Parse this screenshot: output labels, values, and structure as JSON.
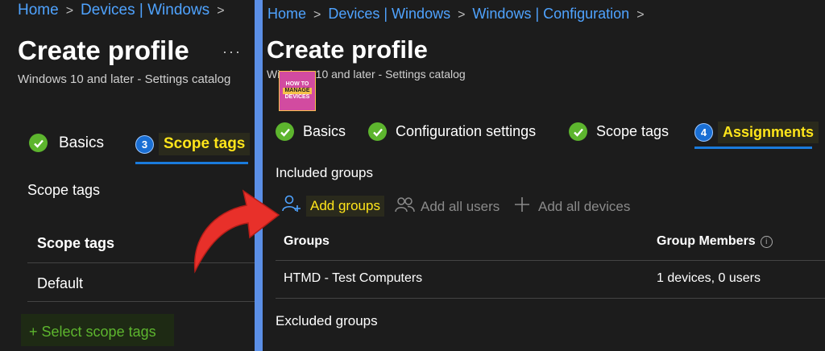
{
  "left": {
    "breadcrumb": [
      "Home",
      "Devices | Windows"
    ],
    "title": "Create profile",
    "subtitle": "Windows 10 and later - Settings catalog",
    "steps": [
      {
        "label": "Basics",
        "state": "done"
      },
      {
        "label": "Scope tags",
        "state": "current",
        "number": "3"
      }
    ],
    "section_label": "Scope tags",
    "table_header": "Scope tags",
    "rows": [
      "Default"
    ],
    "select_link": "+ Select scope tags"
  },
  "right": {
    "breadcrumb": [
      "Home",
      "Devices | Windows",
      "Windows | Configuration"
    ],
    "title": "Create profile",
    "more": "···",
    "subtitle": "Windows 10 and later - Settings catalog",
    "logo": {
      "line1": "HOW TO",
      "line2": "MANAGE",
      "line3": "DEVICES"
    },
    "steps": [
      {
        "label": "Basics",
        "state": "done"
      },
      {
        "label": "Configuration settings",
        "state": "done"
      },
      {
        "label": "Scope tags",
        "state": "done"
      },
      {
        "label": "Assignments",
        "state": "current",
        "number": "4"
      }
    ],
    "included_label": "Included groups",
    "actions": {
      "add_groups": "Add groups",
      "add_all_users": "Add all users",
      "add_all_devices": "Add all devices"
    },
    "table": {
      "col_groups": "Groups",
      "col_members": "Group Members",
      "rows": [
        {
          "group": "HTMD - Test Computers",
          "members": "1 devices, 0 users"
        }
      ]
    },
    "excluded_label": "Excluded groups"
  },
  "colors": {
    "accent": "#1a7bdc",
    "highlight": "#ffe51a",
    "success": "#5db52e",
    "link": "#4fa3ff",
    "arrow": "#e8302a",
    "frame": "#5b8fe6"
  }
}
